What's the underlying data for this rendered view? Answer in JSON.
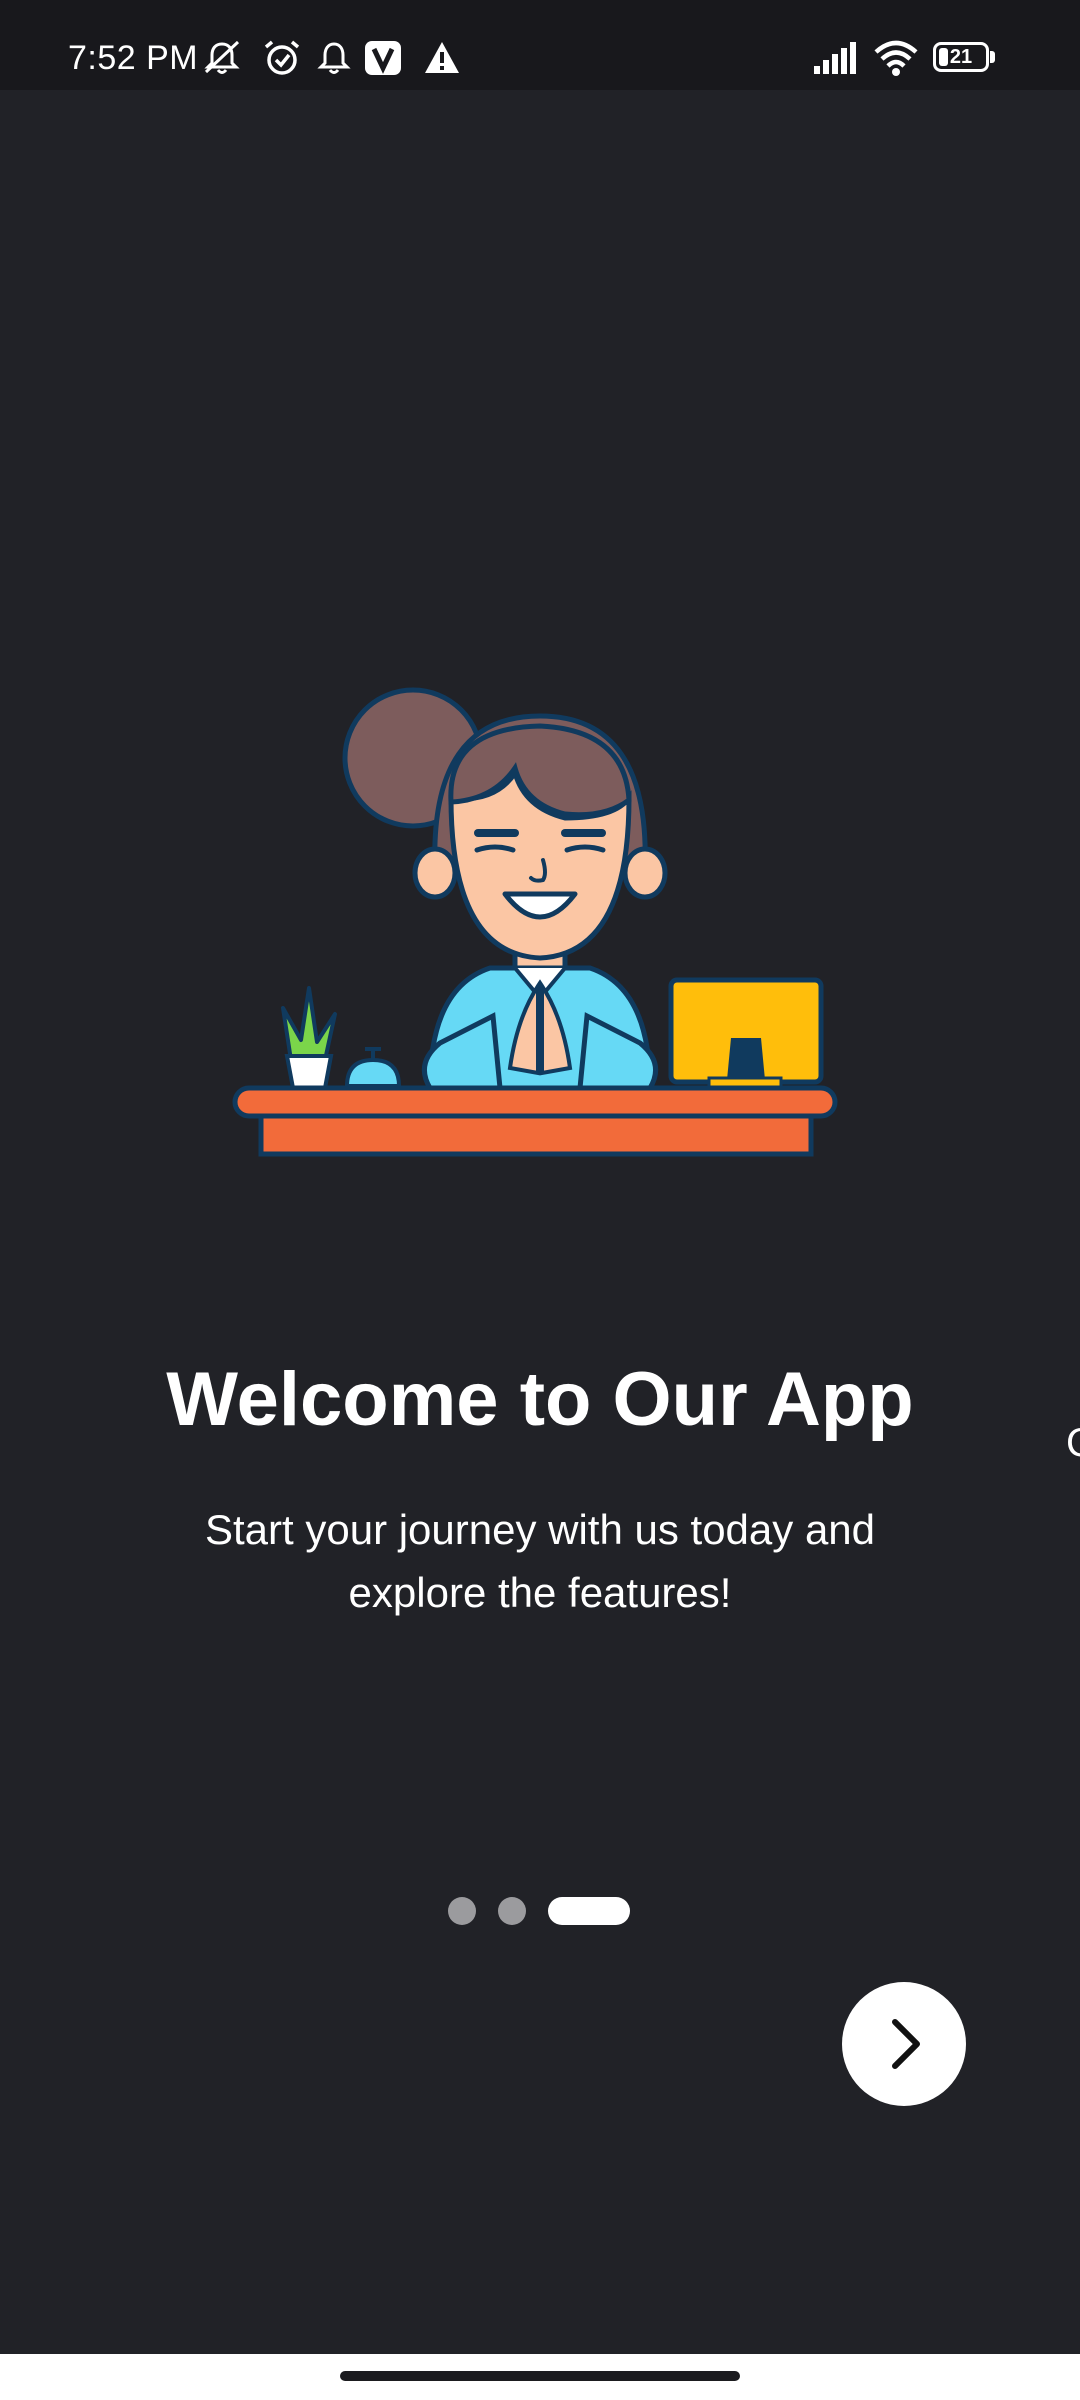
{
  "status_bar": {
    "time": "7:52 PM",
    "icons": [
      "notifications-off-icon",
      "alarm-icon",
      "bell-icon",
      "vpn-v-icon",
      "warning-icon",
      "signal-icon",
      "wifi-icon"
    ],
    "battery_level": "21",
    "battery_fraction": 0.21
  },
  "onboarding": {
    "illustration": "receptionist-greeting-illustration",
    "title": "Welcome to Our App",
    "subtitle": "Start your journey with us today and explore the features!",
    "next_page_edge_glyph": "C",
    "page_count": 3,
    "current_page": 3,
    "next_icon": "chevron-right-icon"
  },
  "colors": {
    "background": "#212227",
    "status_bar": "#18181c",
    "indicator_active": "#ffffff",
    "indicator_inactive": "#9b9b9e",
    "desk": "#f26b3a",
    "monitor": "#ffbe0b",
    "shirt": "#66d9f5",
    "hair": "#7d5c5c",
    "skin": "#fbc6a4",
    "outline": "#103a5e"
  }
}
